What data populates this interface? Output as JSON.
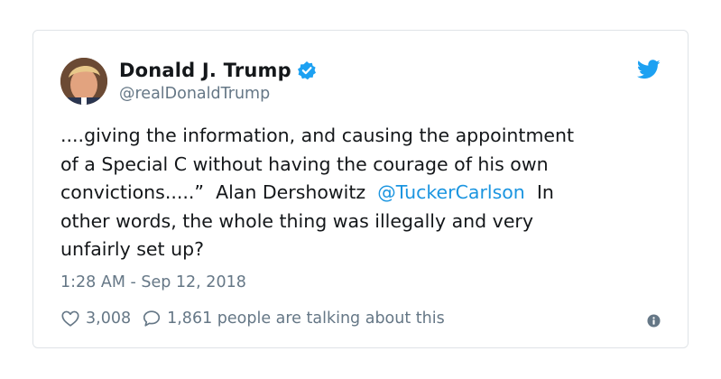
{
  "tweet": {
    "author": {
      "display_name": "Donald J. Trump",
      "handle": "@realDonaldTrump",
      "verified": true
    },
    "text_parts": {
      "line_1": "....giving the information, and causing the appointment",
      "line_2": "of a Special C without having the courage of his own",
      "line_3_before": "convictions.....”  Alan Dershowitz  ",
      "mention": "@TuckerCarlson",
      "line_3_after": "  In",
      "line_4": "other words, the whole thing was illegally and very",
      "line_5": "unfairly set up?"
    },
    "timestamp": "1:28 AM - Sep 12, 2018",
    "likes": "3,008",
    "talking": "1,861 people are talking about this"
  },
  "colors": {
    "accent": "#1da1f2",
    "link": "#1b95e0",
    "text": "#14171a",
    "muted": "#657786"
  },
  "icons": {
    "verified": "verified-badge-icon",
    "brand": "twitter-bird-icon",
    "like": "heart-icon",
    "reply": "speech-bubble-icon",
    "info": "info-icon"
  }
}
